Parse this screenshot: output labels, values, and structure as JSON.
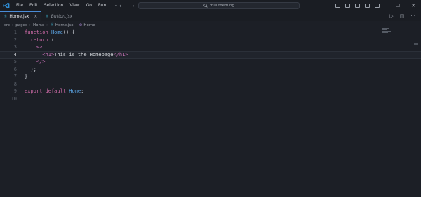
{
  "menu": [
    "File",
    "Edit",
    "Selection",
    "View",
    "Go",
    "Run",
    "···"
  ],
  "nav": {
    "back": "←",
    "forward": "→"
  },
  "search": {
    "text": "mui theming"
  },
  "window": {
    "minimize": "—",
    "maximize": "☐",
    "close": "✕"
  },
  "tabs": [
    {
      "label": "Home.jsx",
      "active": true,
      "close": "×"
    },
    {
      "label": "Button.jsx",
      "active": false
    }
  ],
  "editor_actions": {
    "run": "▷",
    "split": "◫",
    "more": "···"
  },
  "breadcrumb": [
    "src",
    "pages",
    "Home",
    "Home.jsx",
    "Home"
  ],
  "code": {
    "current_line": 4,
    "lines": [
      {
        "n": "1",
        "text": "function Home() {"
      },
      {
        "n": "2",
        "text": "  return ("
      },
      {
        "n": "3",
        "text": "    <>"
      },
      {
        "n": "4",
        "text": "      <h1>This is the Homepage</h1>"
      },
      {
        "n": "5",
        "text": "    </>"
      },
      {
        "n": "6",
        "text": "  );"
      },
      {
        "n": "7",
        "text": "}"
      },
      {
        "n": "8",
        "text": ""
      },
      {
        "n": "9",
        "text": "export default Home;"
      },
      {
        "n": "10",
        "text": ""
      }
    ]
  },
  "colors": {
    "background": "#1c1f26",
    "keyword": "#d06ba9",
    "function": "#5ca7e8",
    "tag": "#c46fb3",
    "accent": "#4a8bd6"
  },
  "icons": [
    "vscode-logo-icon",
    "search-icon",
    "react-file-icon",
    "run-icon",
    "split-editor-icon"
  ]
}
